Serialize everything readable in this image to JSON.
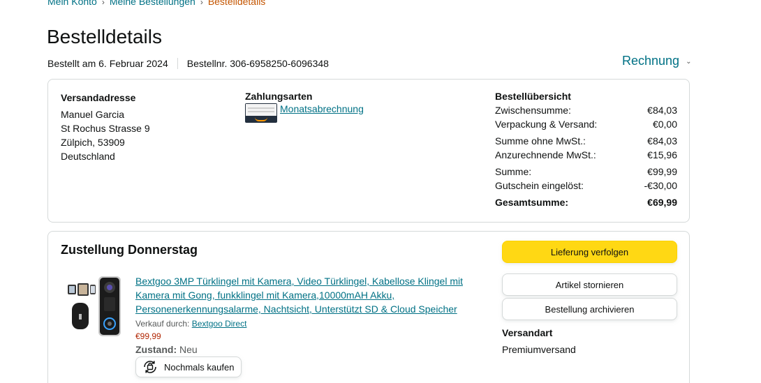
{
  "breadcrumb": {
    "items": [
      "Mein Konto",
      "Meine Bestellungen"
    ],
    "current": "Bestelldetails"
  },
  "page": {
    "title": "Bestelldetails",
    "ordered_on": "Bestellt am 6. Februar 2024",
    "order_number": "Bestellnr. 306-6958250-6096348",
    "invoice_label": "Rechnung"
  },
  "address": {
    "label": "Versandadresse",
    "lines": [
      "Manuel Garcia",
      "St Rochus Strasse 9",
      "Zülpich, 53909",
      "Deutschland"
    ]
  },
  "payment": {
    "label": "Zahlungsarten",
    "method": "Monatsabrechnung"
  },
  "summary": {
    "label": "Bestellübersicht",
    "rows": [
      {
        "label": "Zwischensumme:",
        "value": "€84,03"
      },
      {
        "label": "Verpackung & Versand:",
        "value": "€0,00"
      },
      {
        "label": "Summe ohne MwSt.:",
        "value": "€84,03"
      },
      {
        "label": "Anzurechnende MwSt.:",
        "value": "€15,96"
      },
      {
        "label": "Summe:",
        "value": "€99,99"
      },
      {
        "label": "Gutschein eingelöst:",
        "value": "-€30,00"
      },
      {
        "label": "Gesamtsumme:",
        "value": "€69,99"
      }
    ]
  },
  "shipment": {
    "title": "Zustellung Donnerstag",
    "product_title": "Bextgoo 3MP Türklingel mit Kamera, Video Türklingel, Kabellose Klingel mit Kamera mit Gong, funkklingel mit Kamera,10000mAH Akku, Personenerkennungsalarme, Nachtsicht, Unterstützt SD & Cloud Speicher",
    "seller_prefix": "Verkauf durch:",
    "seller": "Bextgoo Direct",
    "price": "€99,99",
    "condition_label": "Zustand:",
    "condition_value": "Neu",
    "buy_again_label": "Nochmals kaufen",
    "track_label": "Lieferung verfolgen",
    "cancel_label": "Artikel stornieren",
    "archive_label": "Bestellung archivieren",
    "ship_method_label": "Versandart",
    "ship_method_value": "Premiumversand"
  },
  "colors": {
    "link": "#007185",
    "accent_orange": "#c45500",
    "button_yellow": "#ffd814",
    "price_red": "#b12704"
  }
}
